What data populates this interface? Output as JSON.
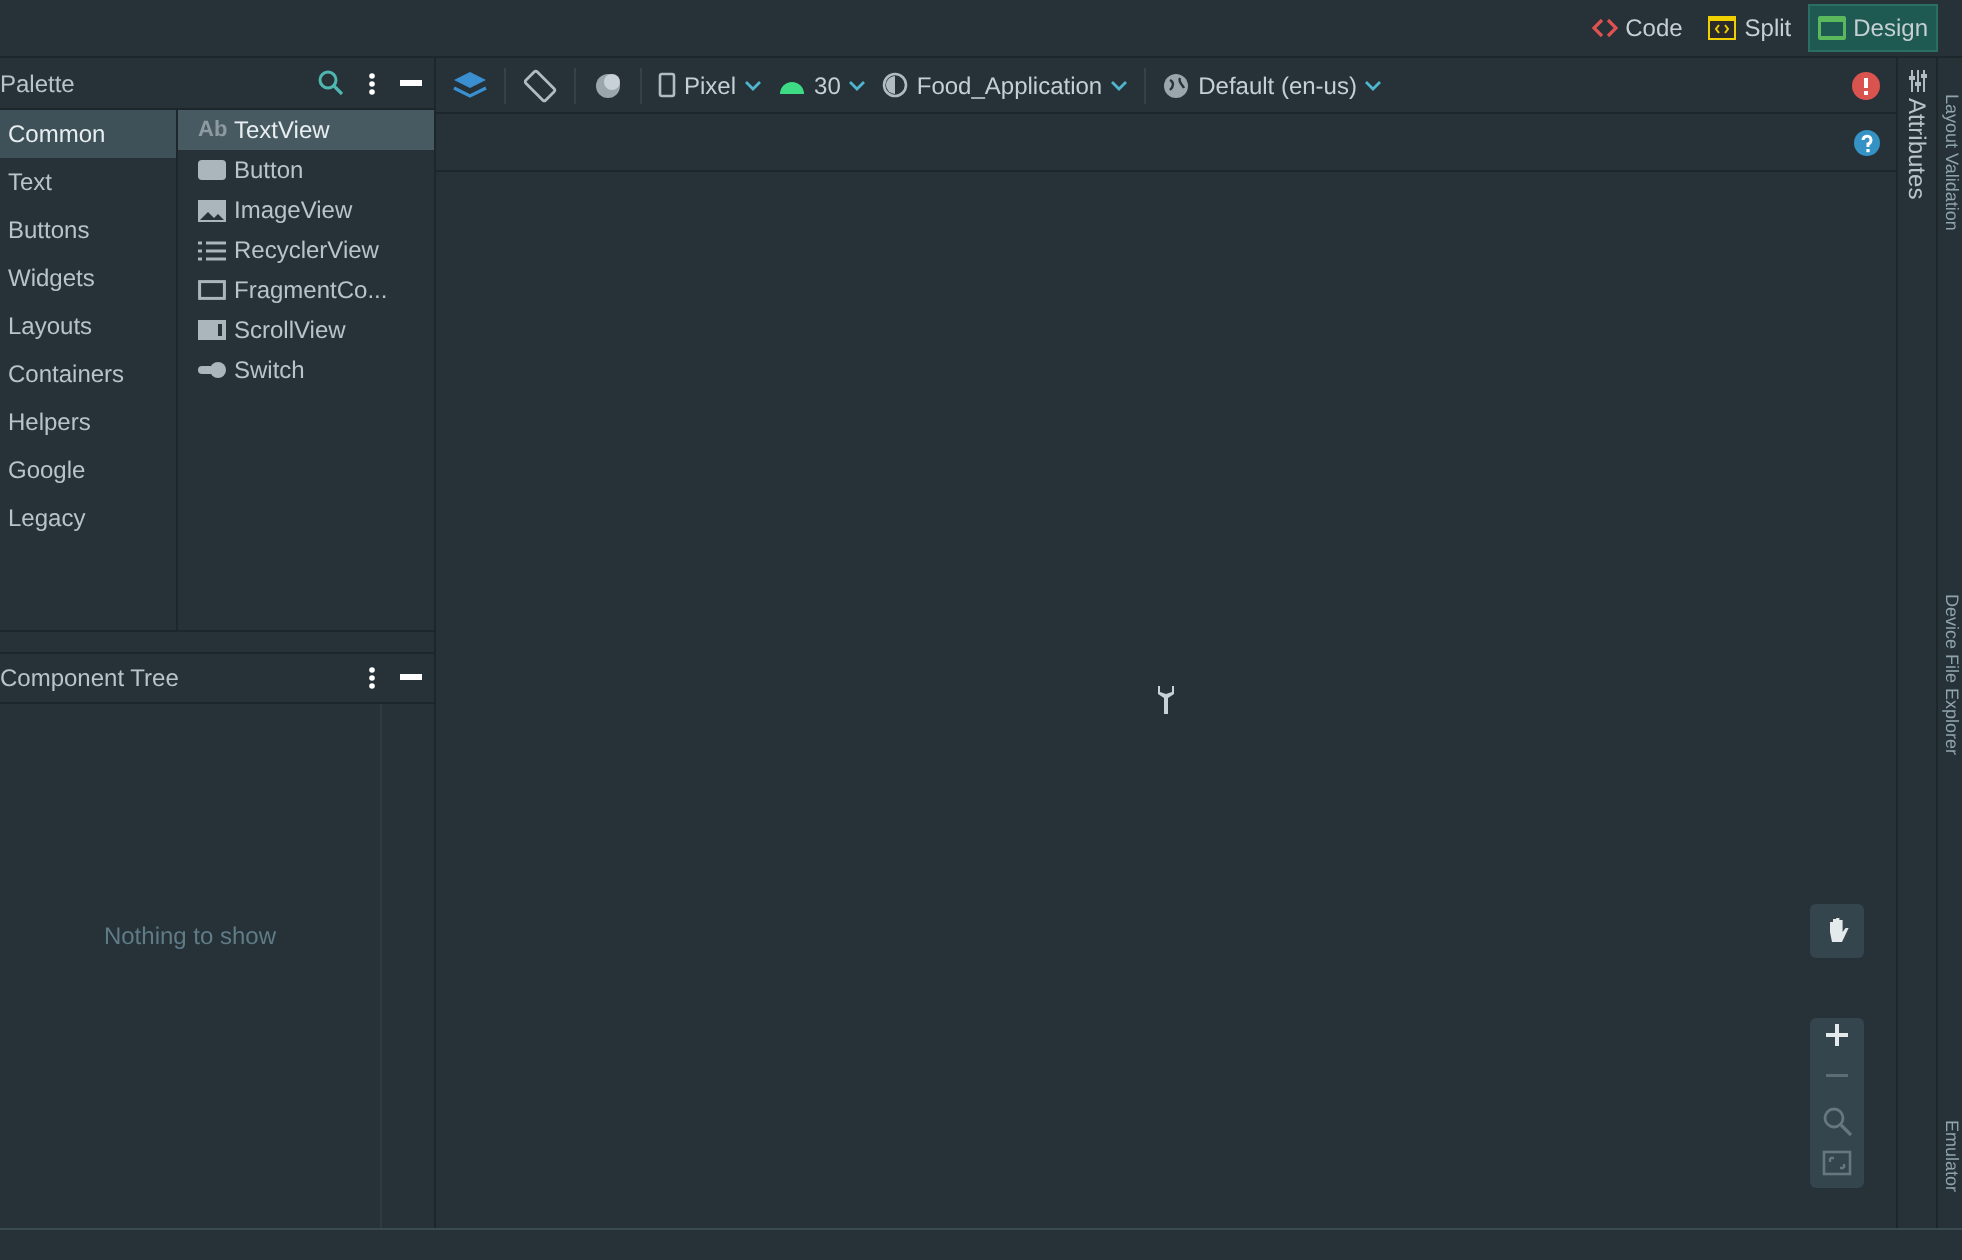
{
  "view_modes": [
    {
      "label": "Code",
      "kind": "code",
      "selected": false
    },
    {
      "label": "Split",
      "kind": "split",
      "selected": false
    },
    {
      "label": "Design",
      "kind": "design",
      "selected": true
    }
  ],
  "palette": {
    "title": "Palette",
    "categories": [
      {
        "label": "Common",
        "selected": true
      },
      {
        "label": "Text",
        "selected": false
      },
      {
        "label": "Buttons",
        "selected": false
      },
      {
        "label": "Widgets",
        "selected": false
      },
      {
        "label": "Layouts",
        "selected": false
      },
      {
        "label": "Containers",
        "selected": false
      },
      {
        "label": "Helpers",
        "selected": false
      },
      {
        "label": "Google",
        "selected": false
      },
      {
        "label": "Legacy",
        "selected": false
      }
    ],
    "items": [
      {
        "label": "TextView",
        "kind": "text",
        "icon_text": "Ab",
        "selected": true
      },
      {
        "label": "Button",
        "kind": "button",
        "selected": false
      },
      {
        "label": "ImageView",
        "kind": "image",
        "selected": false
      },
      {
        "label": "RecyclerView",
        "kind": "list",
        "selected": false
      },
      {
        "label": "FragmentCo...",
        "kind": "fragment",
        "selected": false
      },
      {
        "label": "ScrollView",
        "kind": "scroll",
        "selected": false
      },
      {
        "label": "Switch",
        "kind": "switch",
        "selected": false
      }
    ]
  },
  "toolbar": {
    "device": "Pixel",
    "api": "30",
    "theme": "Food_Application",
    "locale": "Default (en-us)"
  },
  "component_tree": {
    "title": "Component Tree",
    "empty_message": "Nothing to show"
  },
  "side_tabs": {
    "right": [
      "Attributes"
    ],
    "edge": [
      "Layout Validation",
      "Device File Explorer",
      "Emulator"
    ]
  }
}
